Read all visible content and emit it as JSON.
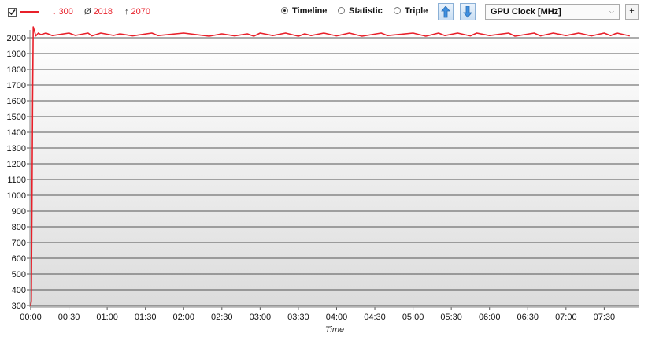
{
  "toolbar": {
    "series_checked": true,
    "series_color": "#e8202a",
    "stats": {
      "min_symbol": "↓",
      "min_value": "300",
      "avg_symbol": "Ø",
      "avg_value": "2018",
      "max_symbol": "↑",
      "max_value": "2070"
    },
    "view_modes": [
      {
        "label": "Timeline",
        "selected": true
      },
      {
        "label": "Statistic",
        "selected": false
      },
      {
        "label": "Triple",
        "selected": false
      }
    ],
    "move_up_icon": "arrow-up-icon",
    "move_down_icon": "arrow-down-icon",
    "sensor_selected": "GPU Clock [MHz]",
    "add_label": "+"
  },
  "chart_data": {
    "type": "line",
    "xlabel": "Time",
    "ylabel": "",
    "ylim": [
      290,
      2050
    ],
    "y_ticks": [
      300,
      400,
      500,
      600,
      700,
      800,
      900,
      1000,
      1100,
      1200,
      1300,
      1400,
      1500,
      1600,
      1700,
      1800,
      1900,
      2000
    ],
    "xlim_minutes": [
      0,
      472
    ],
    "x_tick_labels": [
      "00:00",
      "00:30",
      "01:00",
      "01:30",
      "02:00",
      "02:30",
      "03:00",
      "03:30",
      "04:00",
      "04:30",
      "05:00",
      "05:30",
      "06:00",
      "06:30",
      "07:00",
      "07:30"
    ],
    "grid": true,
    "series": [
      {
        "color": "#e8202a",
        "x_minutes": [
          0,
          0.5,
          1,
          1.5,
          2,
          3,
          4,
          6,
          8,
          12,
          17,
          30,
          35,
          45,
          48,
          55,
          65,
          70,
          80,
          95,
          100,
          120,
          140,
          150,
          160,
          170,
          175,
          180,
          190,
          200,
          210,
          215,
          220,
          230,
          240,
          250,
          260,
          275,
          280,
          300,
          310,
          320,
          325,
          335,
          345,
          350,
          360,
          375,
          380,
          395,
          400,
          410,
          420,
          430,
          440,
          450,
          455,
          460,
          470
        ],
        "values": [
          300,
          330,
          900,
          1600,
          2070,
          2040,
          2012,
          2030,
          2020,
          2030,
          2014,
          2030,
          2015,
          2030,
          2012,
          2030,
          2015,
          2025,
          2012,
          2030,
          2014,
          2030,
          2010,
          2025,
          2012,
          2025,
          2010,
          2030,
          2014,
          2030,
          2010,
          2025,
          2014,
          2030,
          2012,
          2030,
          2010,
          2030,
          2014,
          2030,
          2010,
          2030,
          2014,
          2030,
          2012,
          2030,
          2014,
          2030,
          2010,
          2030,
          2012,
          2030,
          2014,
          2030,
          2012,
          2030,
          2014,
          2030,
          2012
        ]
      }
    ]
  }
}
